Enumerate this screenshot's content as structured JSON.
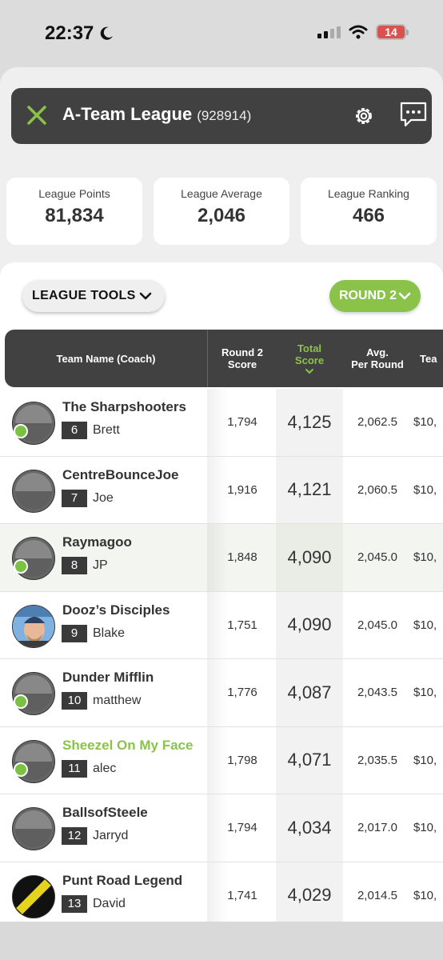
{
  "status": {
    "time": "22:37",
    "battery": "14",
    "moon_icon": "moon-icon",
    "signal_icon": "cellular-signal-icon",
    "wifi_icon": "wifi-icon"
  },
  "header": {
    "title": "A-Team League",
    "code": "(928914)",
    "close_icon": "close-icon",
    "settings_icon": "gear-icon",
    "chat_icon": "chat-icon",
    "accent_color": "#8bc34a"
  },
  "stats": [
    {
      "label": "League Points",
      "value": "81,834"
    },
    {
      "label": "League Average",
      "value": "2,046"
    },
    {
      "label": "League Ranking",
      "value": "466"
    }
  ],
  "controls": {
    "tools_label": "LEAGUE TOOLS",
    "round_label": "ROUND 2"
  },
  "table": {
    "columns": {
      "team": "Team Name (Coach)",
      "round_line1": "Round 2",
      "round_line2": "Score",
      "total_line1": "Total",
      "total_line2": "Score",
      "avg_line1": "Avg.",
      "avg_line2": "Per Round",
      "value": "Tea"
    },
    "rows": [
      {
        "team": "The Sharpshooters",
        "rank": "6",
        "coach": "Brett",
        "round": "1,794",
        "total": "4,125",
        "avg": "2,062.5",
        "value": "$10,",
        "online": true,
        "avatar": "default",
        "highlight": false,
        "green": false
      },
      {
        "team": "CentreBounceJoe",
        "rank": "7",
        "coach": "Joe",
        "round": "1,916",
        "total": "4,121",
        "avg": "2,060.5",
        "value": "$10,",
        "online": false,
        "avatar": "default",
        "highlight": false,
        "green": false
      },
      {
        "team": "Raymagoo",
        "rank": "8",
        "coach": "JP",
        "round": "1,848",
        "total": "4,090",
        "avg": "2,045.0",
        "value": "$10,",
        "online": true,
        "avatar": "default",
        "highlight": true,
        "green": false
      },
      {
        "team": "Dooz’s Disciples",
        "rank": "9",
        "coach": "Blake",
        "round": "1,751",
        "total": "4,090",
        "avg": "2,045.0",
        "value": "$10,",
        "online": false,
        "avatar": "photo",
        "highlight": false,
        "green": false
      },
      {
        "team": "Dunder Mifflin",
        "rank": "10",
        "coach": "matthew",
        "round": "1,776",
        "total": "4,087",
        "avg": "2,043.5",
        "value": "$10,",
        "online": true,
        "avatar": "default",
        "highlight": false,
        "green": false
      },
      {
        "team": "Sheezel On My Face",
        "rank": "11",
        "coach": "alec",
        "round": "1,798",
        "total": "4,071",
        "avg": "2,035.5",
        "value": "$10,",
        "online": true,
        "avatar": "default",
        "highlight": false,
        "green": true
      },
      {
        "team": "BallsofSteele",
        "rank": "12",
        "coach": "Jarryd",
        "round": "1,794",
        "total": "4,034",
        "avg": "2,017.0",
        "value": "$10,",
        "online": false,
        "avatar": "default",
        "highlight": false,
        "green": false
      },
      {
        "team": "Punt Road Legend",
        "rank": "13",
        "coach": "David",
        "round": "1,741",
        "total": "4,029",
        "avg": "2,014.5",
        "value": "$10,",
        "online": false,
        "avatar": "yellow-stripe",
        "highlight": false,
        "green": false
      }
    ]
  }
}
